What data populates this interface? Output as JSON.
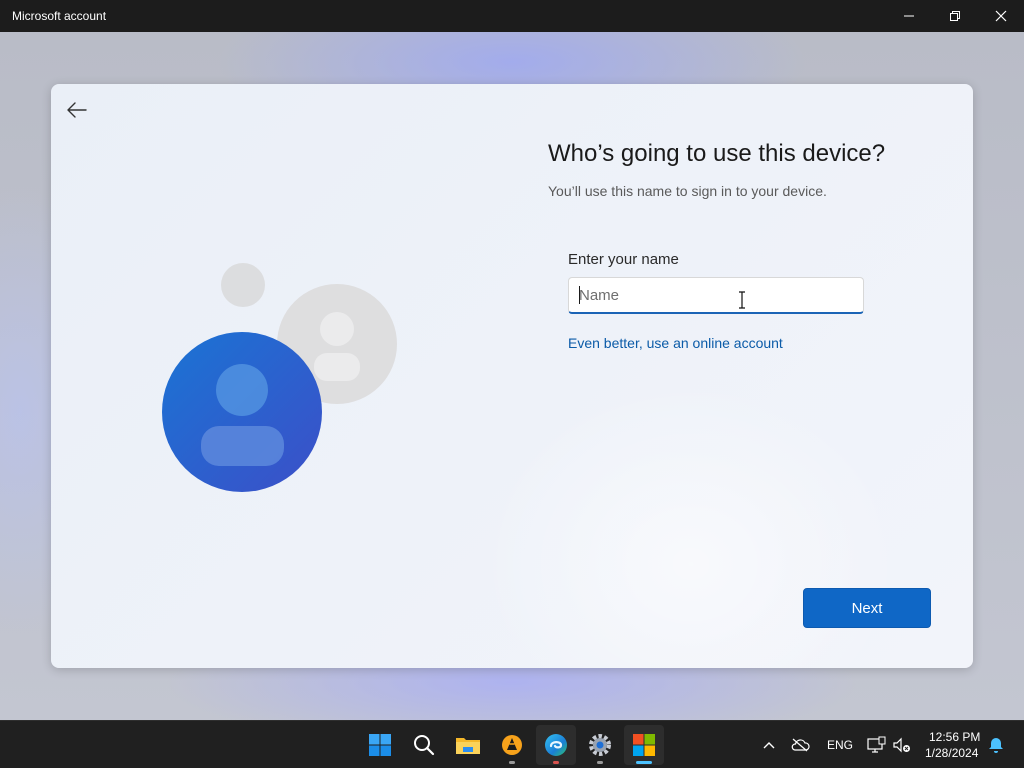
{
  "window": {
    "title": "Microsoft account",
    "controls": {
      "minimize": "minimize",
      "maximize": "restore",
      "close": "close"
    }
  },
  "page": {
    "heading": "Who’s going to use this device?",
    "subheading": "You’ll use this name to sign in to your device.",
    "name_field": {
      "label": "Enter your name",
      "placeholder": "Name",
      "value": ""
    },
    "online_account_link": "Even better, use an online account",
    "next_button": "Next"
  },
  "taskbar": {
    "apps": [
      "start-icon",
      "search-icon",
      "file-explorer-icon",
      "vlc-icon",
      "edge-icon",
      "settings-icon",
      "microsoft-store-icon"
    ],
    "tray": {
      "language": "ENG",
      "time": "12:56 PM",
      "date": "1/28/2024"
    }
  },
  "colors": {
    "accent": "#0f67c6",
    "link": "#0b5ba8",
    "taskbar": "#202020",
    "titlebar": "#1c1c1c"
  }
}
